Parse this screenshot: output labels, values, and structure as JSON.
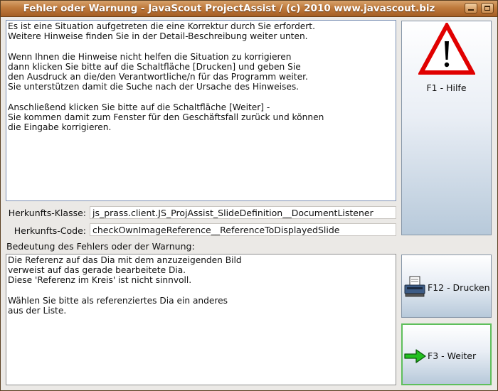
{
  "window": {
    "title": "Fehler oder Warnung - JavaScout ProjectAssist / (c) 2010 www.javascout.biz"
  },
  "instructions_text": "Es ist eine Situation aufgetreten die eine Korrektur durch Sie erfordert.\nWeitere Hinweise finden Sie in der Detail-Beschreibung weiter unten.\n\nWenn Ihnen die Hinweise nicht helfen die Situation zu korrigieren\ndann klicken Sie bitte auf die Schaltfläche [Drucken] und geben Sie\nden Ausdruck an die/den Verantwortliche/n für das Programm weiter.\nSie unterstützen damit die Suche nach der Ursache des Hinweises.\n\nAnschließend klicken Sie bitte auf die Schaltfläche [Weiter] -\nSie kommen damit zum Fenster für den Geschäftsfall zurück und können\ndie Eingabe korrigieren.",
  "origin": {
    "class_label": "Herkunfts-Klasse:",
    "class_value": "js_prass.client.JS_ProjAssist_SlideDefinition__DocumentListener",
    "code_label": "Herkunfts-Code:",
    "code_value": "checkOwnImageReference__ReferenceToDisplayedSlide"
  },
  "meaning": {
    "label": "Bedeutung des Fehlers oder der Warnung:",
    "text": "Die Referenz auf das Dia mit dem anzuzeigenden Bild\nverweist auf das gerade bearbeitete Dia.\nDiese 'Referenz im Kreis' ist nicht sinnvoll.\n\nWählen Sie bitte als referenziertes Dia ein anderes\naus der Liste."
  },
  "buttons": {
    "help": {
      "label": "F1 - Hilfe",
      "icon": "warning-icon"
    },
    "print": {
      "label": "F12 - Drucken",
      "icon": "printer-icon"
    },
    "next": {
      "label": "F3 - Weiter",
      "icon": "arrow-right-icon"
    }
  },
  "colors": {
    "titlebar": "#bf7a3c",
    "warning_red": "#e00000",
    "next_border": "#5fbf5c",
    "arrow_green": "#22c020"
  }
}
